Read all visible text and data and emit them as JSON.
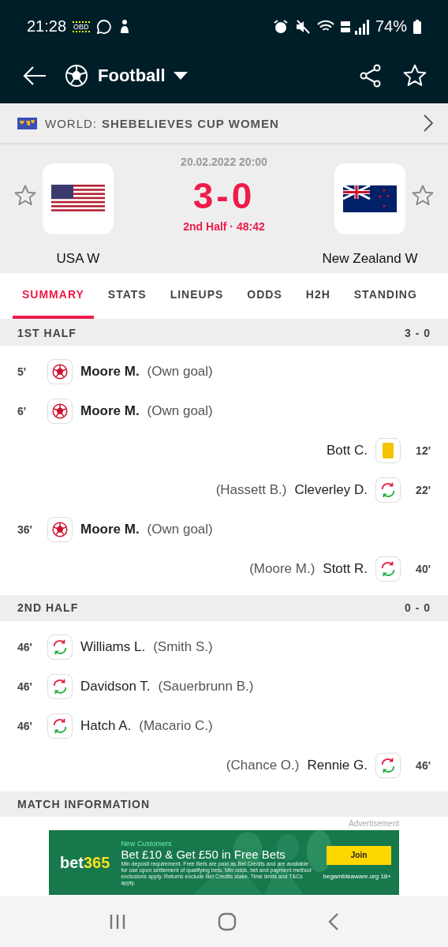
{
  "status_bar": {
    "time": "21:28",
    "obd": "OBD",
    "battery": "74%"
  },
  "app_bar": {
    "sport": "Football"
  },
  "league": {
    "country": "WORLD:",
    "name": "SHEBELIEVES CUP WOMEN"
  },
  "match": {
    "datetime": "20.02.2022 20:00",
    "score": "3-0",
    "status": "2nd Half · 48:42",
    "home": {
      "name": "USA W"
    },
    "away": {
      "name": "New Zealand W"
    }
  },
  "tabs": [
    {
      "label": "SUMMARY",
      "selected": true
    },
    {
      "label": "STATS",
      "selected": false
    },
    {
      "label": "LINEUPS",
      "selected": false
    },
    {
      "label": "ODDS",
      "selected": false
    },
    {
      "label": "H2H",
      "selected": false
    },
    {
      "label": "STANDING",
      "selected": false
    }
  ],
  "periods": [
    {
      "title": "1ST HALF",
      "score": "3 - 0",
      "events": [
        {
          "away": false,
          "kind": "goal",
          "minute": "5'",
          "player": "Moore M.",
          "detail": "(Own goal)"
        },
        {
          "away": false,
          "kind": "goal",
          "minute": "6'",
          "player": "Moore M.",
          "detail": "(Own goal)"
        },
        {
          "away": true,
          "kind": "yellow",
          "minute": "12'",
          "player": "Bott C."
        },
        {
          "away": true,
          "kind": "sub",
          "minute": "22'",
          "player": "Cleverley D.",
          "detail": "(Hassett B.)"
        },
        {
          "away": false,
          "kind": "goal",
          "minute": "36'",
          "player": "Moore M.",
          "detail": "(Own goal)"
        },
        {
          "away": true,
          "kind": "sub",
          "minute": "40'",
          "player": "Stott R.",
          "detail": "(Moore M.)"
        }
      ]
    },
    {
      "title": "2ND HALF",
      "score": "0 - 0",
      "events": [
        {
          "away": false,
          "kind": "sub",
          "minute": "46'",
          "player": "Williams L.",
          "detail": "(Smith S.)"
        },
        {
          "away": false,
          "kind": "sub",
          "minute": "46'",
          "player": "Davidson T.",
          "detail": "(Sauerbrunn B.)"
        },
        {
          "away": false,
          "kind": "sub",
          "minute": "46'",
          "player": "Hatch A.",
          "detail": "(Macario C.)"
        },
        {
          "away": true,
          "kind": "sub",
          "minute": "46'",
          "player": "Rennie G.",
          "detail": "(Chance O.)"
        }
      ]
    }
  ],
  "section_heading": "MATCH INFORMATION",
  "ad": {
    "label": "Advertisement",
    "brand": "bet",
    "brand_accent": "365",
    "eyebrow": "New Customers",
    "headline": "Bet £10 & Get £50 in Free Bets",
    "fine_print": "Min deposit requirement. Free Bets are paid as Bet Credits and are available for use upon settlement of qualifying bets. Min odds, bet and payment method exclusions apply. Returns exclude Bet Credits stake. Time limits and T&Cs apply.",
    "button": "Join",
    "footer": "begambleaware.org  18+"
  }
}
